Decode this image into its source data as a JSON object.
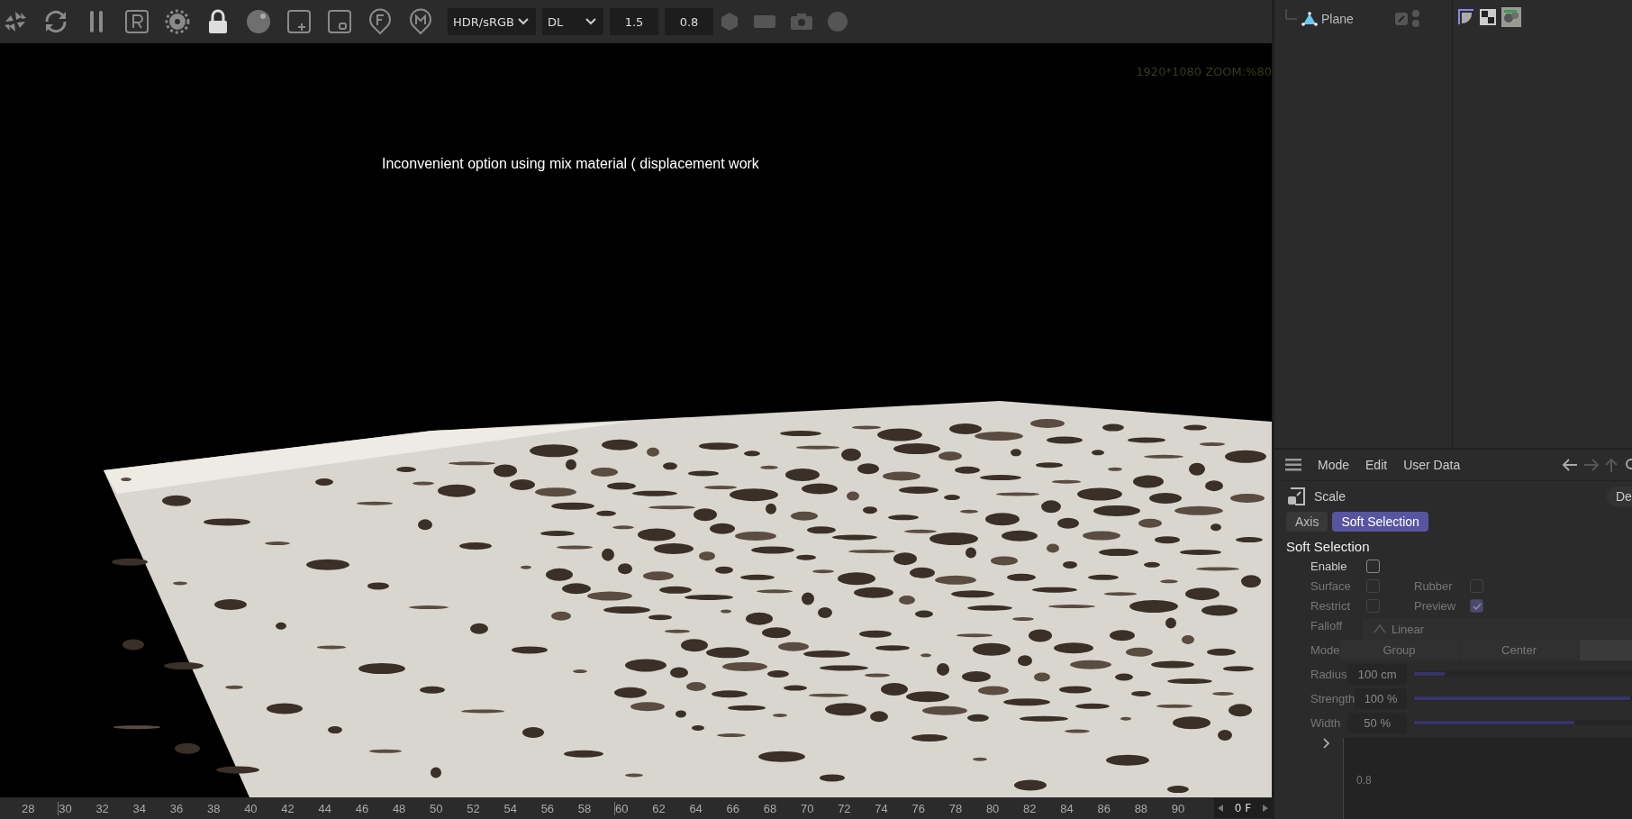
{
  "toolbar": {
    "dropdowns": [
      {
        "value": "HDR/sRGB"
      },
      {
        "value": "DL"
      }
    ],
    "fields": [
      {
        "value": "1.5"
      },
      {
        "value": "0.8"
      }
    ]
  },
  "viewport": {
    "resolution_label": "1920*1080 ZOOM:%80",
    "caption": "Inconvenient option using mix material ( displacement work"
  },
  "timeline": {
    "ticks": [
      "28",
      "30",
      "32",
      "34",
      "36",
      "38",
      "40",
      "42",
      "44",
      "46",
      "48",
      "50",
      "52",
      "54",
      "56",
      "58",
      "60",
      "62",
      "64",
      "66",
      "68",
      "70",
      "72",
      "74",
      "76",
      "78",
      "80",
      "82",
      "84",
      "86",
      "88",
      "90"
    ],
    "frame_field": "0 F"
  },
  "object_manager": {
    "objects": [
      {
        "name": "Plane"
      }
    ]
  },
  "attributes": {
    "menu": [
      "Mode",
      "Edit",
      "User Data"
    ],
    "object_title": "Scale",
    "cut_button": "De",
    "tabs": [
      {
        "label": "Axis",
        "selected": false
      },
      {
        "label": "Soft Selection",
        "selected": true
      }
    ],
    "section_title": "Soft Selection",
    "checkboxes": [
      {
        "label": "Enable",
        "checked": false,
        "disabled": false
      },
      {
        "label": "Surface",
        "checked": false,
        "disabled": true
      },
      {
        "label": "Rubber",
        "checked": false,
        "disabled": true
      },
      {
        "label": "Restrict",
        "checked": false,
        "disabled": true
      },
      {
        "label": "Preview",
        "checked": true,
        "disabled": true
      }
    ],
    "falloff": {
      "label": "Falloff",
      "value": "Linear"
    },
    "mode": {
      "label": "Mode",
      "options": [
        {
          "label": "Group",
          "selected": false
        },
        {
          "label": "Center",
          "selected": false
        }
      ]
    },
    "sliders": [
      {
        "label": "Radius",
        "value": "100 cm",
        "level": 0.14
      },
      {
        "label": "Strength",
        "value": "100 %",
        "level": 1
      },
      {
        "label": "Width",
        "value": "50 %",
        "level": 0.74
      }
    ],
    "graph_label": "0.8"
  }
}
